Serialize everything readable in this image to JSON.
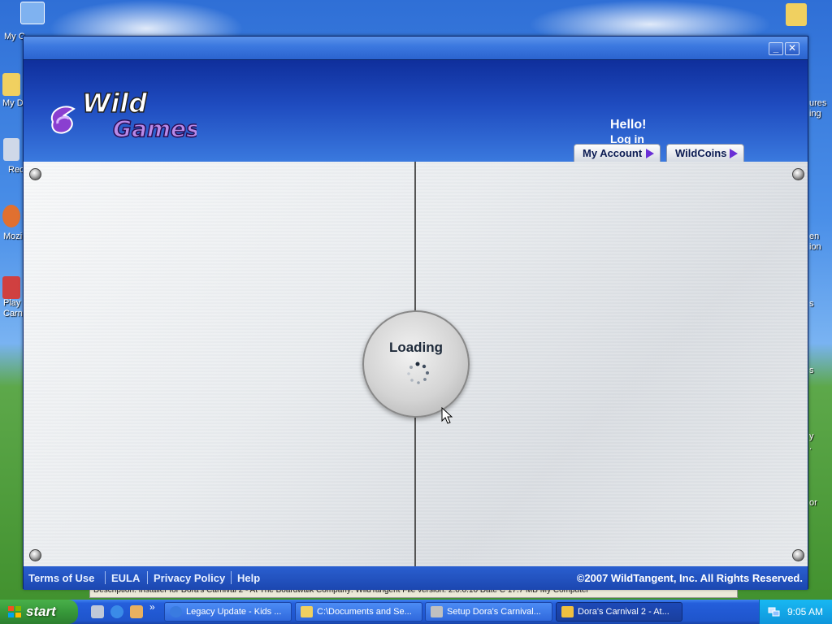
{
  "desktop": {
    "icons": [
      {
        "label": "My C",
        "color": "#7fb2f0"
      },
      {
        "label": "My D",
        "color": "#f0d060"
      },
      {
        "label": "Rec",
        "color": "#cfd8e8"
      },
      {
        "label": "Mozil",
        "color": "#e07030"
      },
      {
        "label": "Play\nCarni",
        "color": "#d04040"
      }
    ],
    "right_labels": [
      "ures",
      "ing",
      "en",
      "ion",
      "s",
      "s",
      "y",
      ".",
      "or"
    ]
  },
  "window": {
    "minimize_label": "_",
    "close_label": "✕",
    "header": {
      "logo_line1": "Wild",
      "logo_line2": "Games",
      "greeting": "Hello!",
      "login_label": "Log in",
      "tabs": [
        {
          "label": "My Account"
        },
        {
          "label": "WildCoins"
        }
      ]
    },
    "content": {
      "loading_label": "Loading"
    },
    "footer": {
      "links": [
        "Terms of Use",
        "EULA",
        "Privacy Policy",
        "Help"
      ],
      "copyright": "©2007 WildTangent, Inc. All Rights Reserved."
    }
  },
  "status_behind": "Description: Installer for Dora's Carnival 2 - At The Boardwalk Company: WildTangent File version: 2.0.0.10 Date C  17.7 MB        My Computer",
  "taskbar": {
    "start_label": "start",
    "quicklaunch_more": "»",
    "tasks": [
      {
        "label": "Legacy Update - Kids ...",
        "active": false,
        "icon_color": "#3a7be0"
      },
      {
        "label": "C:\\Documents and Se...",
        "active": false,
        "icon_color": "#f0d060"
      },
      {
        "label": "Setup Dora's Carnival...",
        "active": false,
        "icon_color": "#c0c0c0"
      },
      {
        "label": "Dora's Carnival 2 - At...",
        "active": true,
        "icon_color": "#f0c040"
      }
    ],
    "clock": "9:05 AM"
  }
}
